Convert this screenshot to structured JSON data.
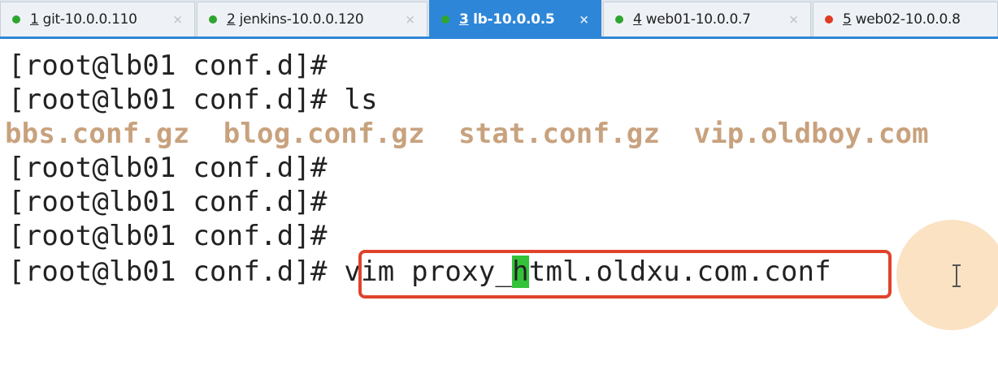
{
  "tabs": [
    {
      "number": "1",
      "name": " git-10.0.0.110",
      "dot_color": "#2fa52f",
      "active": false
    },
    {
      "number": "2",
      "name": " jenkins-10.0.0.120",
      "dot_color": "#2fa52f",
      "active": false
    },
    {
      "number": "3",
      "name": " lb-10.0.0.5",
      "dot_color": "#2fa52f",
      "active": true
    },
    {
      "number": "4",
      "name": " web01-10.0.0.7",
      "dot_color": "#2fa52f",
      "active": false
    },
    {
      "number": "5",
      "name": " web02-10.0.0.8",
      "dot_color": "#e03a22",
      "active": false
    }
  ],
  "close_symbol": "×",
  "terminal": {
    "prompt": "[root@lb01 conf.d]#",
    "lines": [
      {
        "prompt": "[root@lb01 conf.d]#",
        "command": ""
      },
      {
        "prompt": "[root@lb01 conf.d]#",
        "command": " ls"
      },
      {
        "output": "bbs.conf.gz  blog.conf.gz  stat.conf.gz  vip.oldboy.com"
      },
      {
        "prompt": "[root@lb01 conf.d]#",
        "command": ""
      },
      {
        "prompt": "[root@lb01 conf.d]#",
        "command": ""
      },
      {
        "prompt": "[root@lb01 conf.d]#",
        "command": ""
      }
    ],
    "current_line": {
      "prompt": "[root@lb01 conf.d]#",
      "command_before_cursor": "vim proxy_",
      "cursor_char": "h",
      "command_after_cursor": "tml.oldxu.com.conf"
    }
  },
  "colors": {
    "tab_active": "#2e86d8",
    "ls_output": "#c8a27e",
    "cursor": "#33c23a",
    "highlight_box": "#e0432b"
  }
}
